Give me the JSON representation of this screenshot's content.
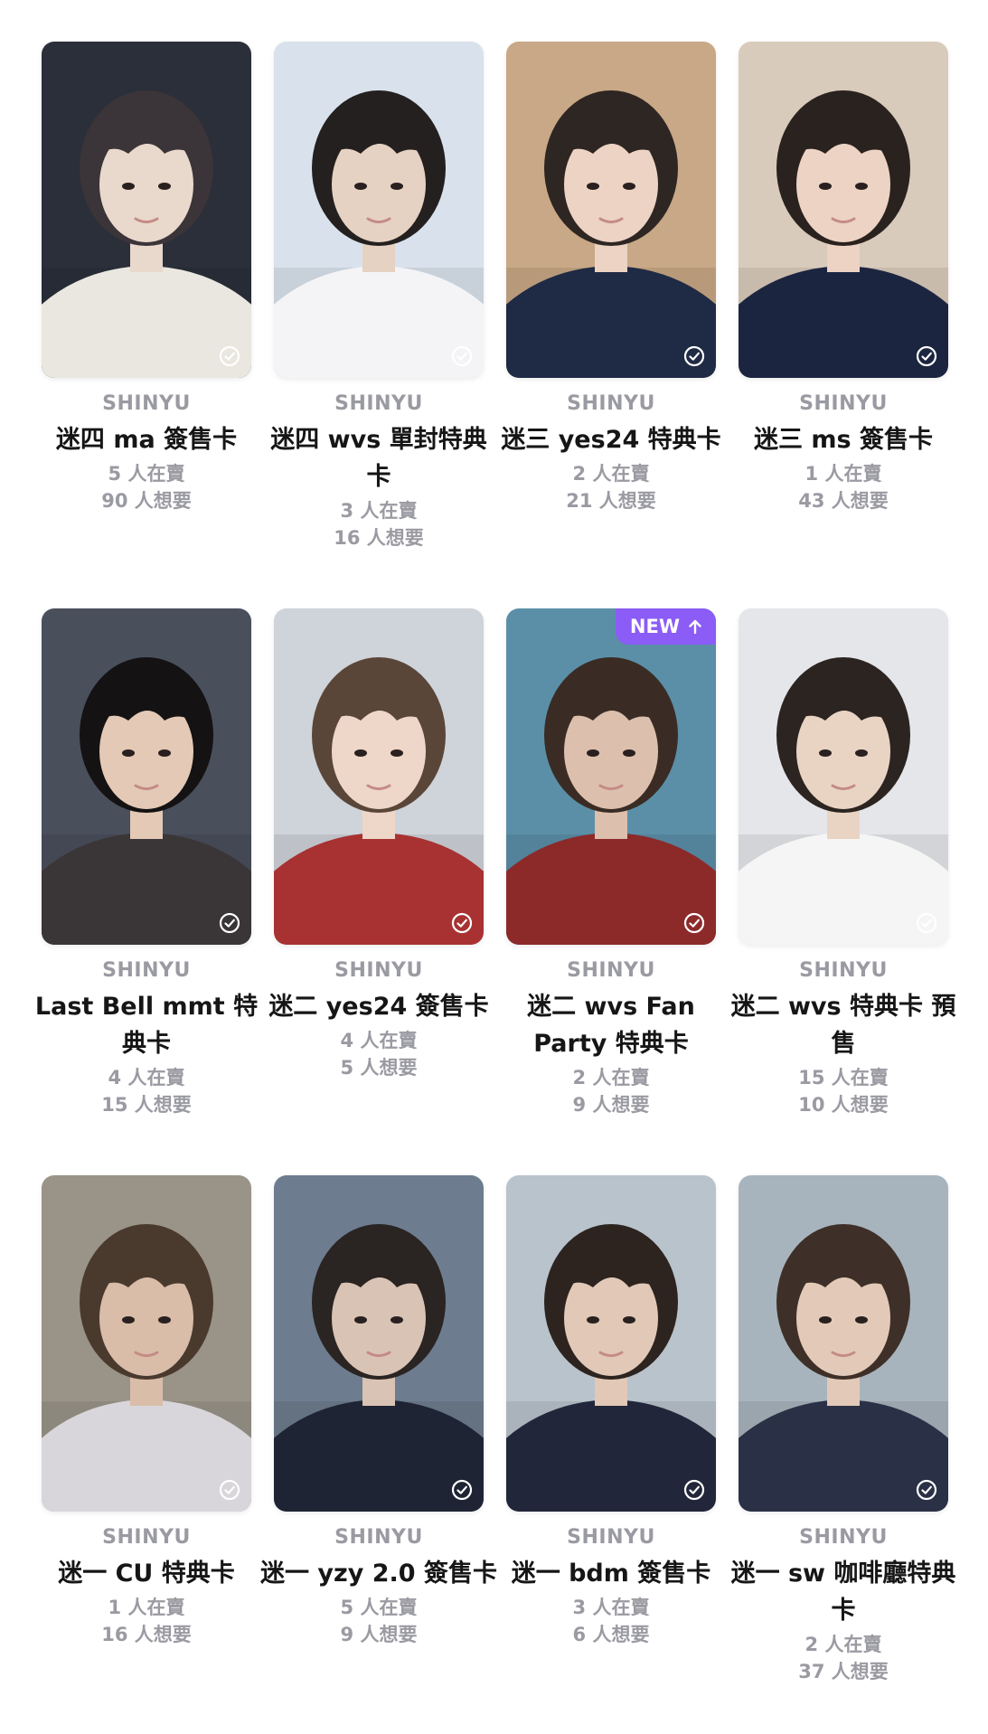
{
  "colors": {
    "artist_text": "#9a9aa2",
    "title_text": "#161616",
    "new_badge": "#8b5cf6"
  },
  "icons": {
    "check": "check-circle-icon",
    "new_arrow": "arrow-up-icon"
  },
  "cards": [
    {
      "artist": "SHINYU",
      "title": "迷四 ma 簽售卡",
      "selling": "5 人在賣",
      "wanting": "90 人想要",
      "is_new": false,
      "photo": {
        "bg": "#2a2f3a",
        "skin": "#e9d9cc",
        "hair": "#3b3438",
        "shirt": "#e9e7df"
      }
    },
    {
      "artist": "SHINYU",
      "title": "迷四 wvs 單封特典卡",
      "selling": "3 人在賣",
      "wanting": "16 人想要",
      "is_new": false,
      "photo": {
        "bg": "#d9e2ec",
        "skin": "#e6d2c2",
        "hair": "#24201f",
        "shirt": "#f4f4f6"
      }
    },
    {
      "artist": "SHINYU",
      "title": "迷三 yes24 特典卡",
      "selling": "2 人在賣",
      "wanting": "21 人想要",
      "is_new": false,
      "photo": {
        "bg": "#c8a886",
        "skin": "#ecd3c3",
        "hair": "#2e2622",
        "shirt": "#1f2a44"
      }
    },
    {
      "artist": "SHINYU",
      "title": "迷三 ms 簽售卡",
      "selling": "1 人在賣",
      "wanting": "43 人想要",
      "is_new": false,
      "photo": {
        "bg": "#d9cbbb",
        "skin": "#ecd3c3",
        "hair": "#2a221e",
        "shirt": "#1c2540"
      }
    },
    {
      "artist": "SHINYU",
      "title": "Last Bell mmt 特典卡",
      "selling": "4 人在賣",
      "wanting": "15 人想要",
      "is_new": false,
      "photo": {
        "bg": "#4a4f5c",
        "skin": "#e3c9b6",
        "hair": "#141212",
        "shirt": "#3a3638"
      }
    },
    {
      "artist": "SHINYU",
      "title": "迷二 yes24 簽售卡",
      "selling": "4 人在賣",
      "wanting": "5 人想要",
      "is_new": false,
      "photo": {
        "bg": "#cfd3da",
        "skin": "#eed7c8",
        "hair": "#5a4638",
        "shirt": "#a83232"
      }
    },
    {
      "artist": "SHINYU",
      "title": "迷二 wvs Fan Party 特典卡",
      "selling": "2 人在賣",
      "wanting": "9 人想要",
      "is_new": true,
      "new_label": "NEW",
      "photo": {
        "bg": "#5b8fa8",
        "skin": "#dcbfad",
        "hair": "#3a2c24",
        "shirt": "#8c2a2a"
      }
    },
    {
      "artist": "SHINYU",
      "title": "迷二 wvs 特典卡 預售",
      "selling": "15 人在賣",
      "wanting": "10 人想要",
      "is_new": false,
      "photo": {
        "bg": "#e4e6ea",
        "skin": "#e9d4c4",
        "hair": "#2c2420",
        "shirt": "#f5f5f5"
      }
    },
    {
      "artist": "SHINYU",
      "title": "迷一 CU 特典卡",
      "selling": "1 人在賣",
      "wanting": "16 人想要",
      "is_new": false,
      "photo": {
        "bg": "#9a9488",
        "skin": "#d9bda9",
        "hair": "#4a3a2e",
        "shirt": "#d8d6da"
      }
    },
    {
      "artist": "SHINYU",
      "title": "迷一 yzy 2.0 簽售卡",
      "selling": "5 人在賣",
      "wanting": "9 人想要",
      "is_new": false,
      "photo": {
        "bg": "#6d7c8e",
        "skin": "#d9c3b4",
        "hair": "#2a2422",
        "shirt": "#1e2434"
      }
    },
    {
      "artist": "SHINYU",
      "title": "迷一 bdm 簽售卡",
      "selling": "3 人在賣",
      "wanting": "6 人想要",
      "is_new": false,
      "photo": {
        "bg": "#b9c3cc",
        "skin": "#e2c8b6",
        "hair": "#2d2420",
        "shirt": "#22263a"
      }
    },
    {
      "artist": "SHINYU",
      "title": "迷一 sw 咖啡廳特典卡",
      "selling": "2 人在賣",
      "wanting": "37 人想要",
      "is_new": false,
      "photo": {
        "bg": "#a8b4bd",
        "skin": "#e3cab8",
        "hair": "#3e3028",
        "shirt": "#2a3046"
      }
    }
  ]
}
